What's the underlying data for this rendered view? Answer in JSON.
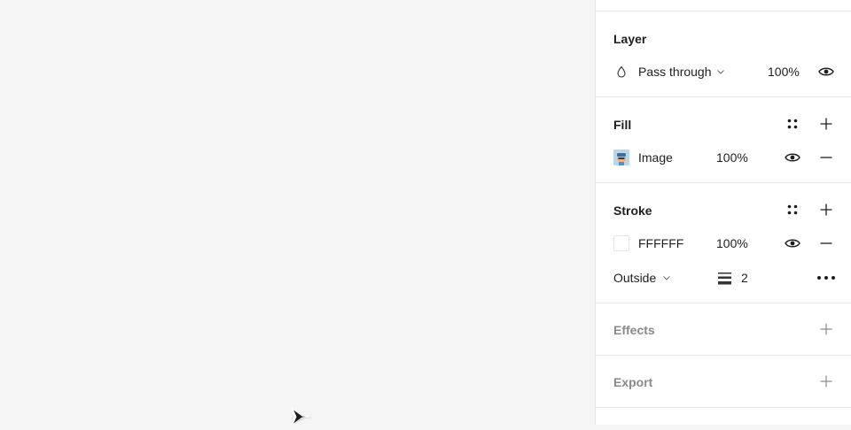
{
  "layer": {
    "title": "Layer",
    "blend_icon": "drop-icon",
    "blend_mode": "Pass through",
    "opacity": "100%",
    "visibility_icon": "eye-icon"
  },
  "fill": {
    "title": "Fill",
    "style_icon": "styles-grid-icon",
    "add_icon": "plus-icon",
    "item": {
      "type_label": "Image",
      "opacity": "100%",
      "visibility_icon": "eye-icon",
      "remove_icon": "minus-icon"
    }
  },
  "stroke": {
    "title": "Stroke",
    "style_icon": "styles-grid-icon",
    "add_icon": "plus-icon",
    "item": {
      "color_hex": "FFFFFF",
      "swatch_color": "#ffffff",
      "opacity": "100%",
      "visibility_icon": "eye-icon",
      "remove_icon": "minus-icon"
    },
    "position": "Outside",
    "weight_icon": "stroke-weight-icon",
    "weight": "2",
    "more_icon": "more-horizontal-icon"
  },
  "effects": {
    "title": "Effects",
    "add_icon": "plus-icon"
  },
  "export": {
    "title": "Export",
    "add_icon": "plus-icon"
  },
  "cursor_icon": "multiplayer-cursor-icon"
}
